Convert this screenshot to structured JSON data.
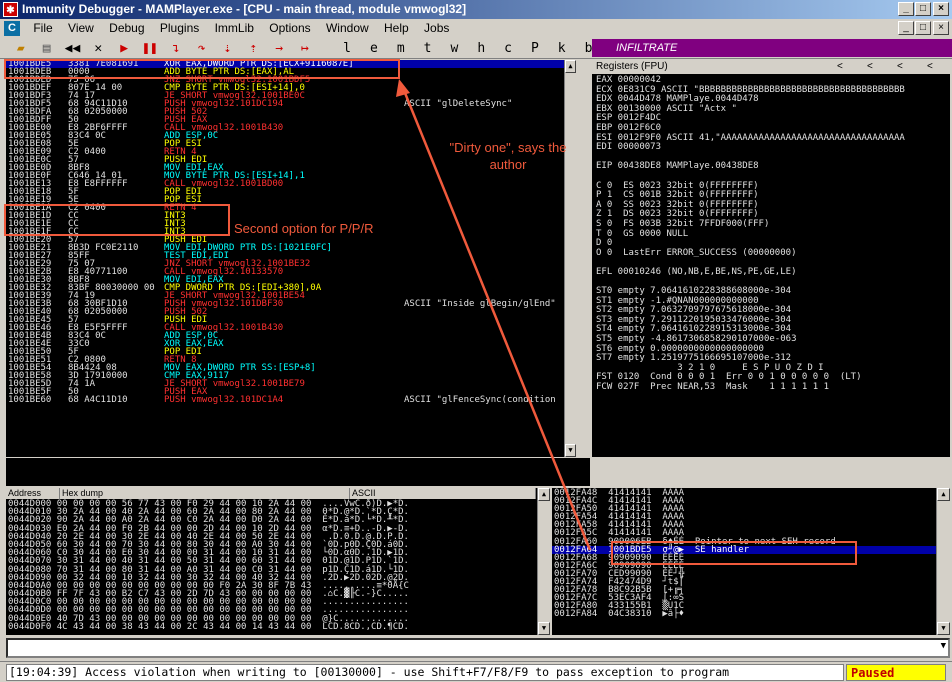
{
  "window": {
    "title": "Immunity Debugger - MAMPlayer.exe - [CPU - main thread, module vmwogl32]",
    "title_icon": "bug-icon",
    "controls": [
      "_",
      "□",
      "×"
    ],
    "mdi_controls": [
      "_",
      "□",
      "×"
    ]
  },
  "menu": [
    "File",
    "View",
    "Debug",
    "Plugins",
    "ImmLib",
    "Options",
    "Window",
    "Help",
    "Jobs"
  ],
  "toolbar": {
    "letters": [
      "l",
      "e",
      "m",
      "t",
      "w",
      "h",
      "c",
      "P",
      "k",
      "b",
      "z",
      "r",
      "...",
      "s",
      "?"
    ],
    "infiltrate": "INFILTRATE"
  },
  "disasm": [
    {
      "a": "1001BDE5",
      "h": "3381 7E081691",
      "i": "XOR EAX,DWORD PTR DS:[ECX+9116087E]",
      "k": "wht",
      "c": ""
    },
    {
      "a": "1001BDEB",
      "h": "0000",
      "i": "ADD BYTE PTR DS:[EAX],AL",
      "k": "yel",
      "c": ""
    },
    {
      "a": "1001BDED",
      "h": "75 06",
      "i": "JNZ SHORT vmwogl32.1001BDF5",
      "k": "red",
      "c": ""
    },
    {
      "a": "1001BDEF",
      "h": "807E 14 00",
      "i": "CMP BYTE PTR DS:[ESI+14],0",
      "k": "yel",
      "c": ""
    },
    {
      "a": "1001BDF3",
      "h": "74 17",
      "i": "JE SHORT vmwogl32.1001BE0C",
      "k": "red",
      "c": ""
    },
    {
      "a": "1001BDF5",
      "h": "68 94C11D10",
      "i": "PUSH vmwogl32.101DC194",
      "k": "red",
      "c": "ASCII \"glDeleteSync\""
    },
    {
      "a": "1001BDFA",
      "h": "68 02050000",
      "i": "PUSH 502",
      "k": "red",
      "c": ""
    },
    {
      "a": "1001BDFF",
      "h": "50",
      "i": "PUSH EAX",
      "k": "red",
      "c": ""
    },
    {
      "a": "1001BE00",
      "h": "E8 2BF6FFFF",
      "i": "CALL vmwogl32.1001B430",
      "k": "red",
      "c": ""
    },
    {
      "a": "1001BE05",
      "h": "83C4 0C",
      "i": "ADD ESP,0C",
      "k": "cyan",
      "c": ""
    },
    {
      "a": "1001BE08",
      "h": "5E",
      "i": "POP ESI",
      "k": "yel",
      "c": ""
    },
    {
      "a": "1001BE09",
      "h": "C2 0400",
      "i": "RETN 4",
      "k": "red",
      "c": ""
    },
    {
      "a": "1001BE0C",
      "h": "57",
      "i": "PUSH EDI",
      "k": "yel",
      "c": ""
    },
    {
      "a": "1001BE0D",
      "h": "8BF8",
      "i": "MOV EDI,EAX",
      "k": "cyan",
      "c": ""
    },
    {
      "a": "1001BE0F",
      "h": "C646 14 01",
      "i": "MOV BYTE PTR DS:[ESI+14],1",
      "k": "cyan",
      "c": ""
    },
    {
      "a": "1001BE13",
      "h": "E8 E8FFFFFF",
      "i": "CALL vmwogl32.1001BD00",
      "k": "red",
      "c": ""
    },
    {
      "a": "1001BE18",
      "h": "5F",
      "i": "POP EDI",
      "k": "yel",
      "c": ""
    },
    {
      "a": "1001BE19",
      "h": "5E",
      "i": "POP ESI",
      "k": "yel",
      "c": ""
    },
    {
      "a": "1001BE1A",
      "h": "C2 0400",
      "i": "RETN 4",
      "k": "red",
      "c": ""
    },
    {
      "a": "1001BE1D",
      "h": "CC",
      "i": "INT3",
      "k": "yel",
      "c": ""
    },
    {
      "a": "1001BE1E",
      "h": "CC",
      "i": "INT3",
      "k": "yel",
      "c": ""
    },
    {
      "a": "1001BE1F",
      "h": "CC",
      "i": "INT3",
      "k": "yel",
      "c": ""
    },
    {
      "a": "1001BE20",
      "h": "57",
      "i": "PUSH EDI",
      "k": "yel",
      "c": ""
    },
    {
      "a": "1001BE21",
      "h": "8B3D FC0E2110",
      "i": "MOV EDI,DWORD PTR DS:[1021E0FC]",
      "k": "cyan",
      "c": ""
    },
    {
      "a": "1001BE27",
      "h": "85FF",
      "i": "TEST EDI,EDI",
      "k": "cyan",
      "c": ""
    },
    {
      "a": "1001BE29",
      "h": "75 07",
      "i": "JNZ SHORT vmwogl32.1001BE32",
      "k": "red",
      "c": ""
    },
    {
      "a": "1001BE2B",
      "h": "E8 40771100",
      "i": "CALL vmwogl32.10133570",
      "k": "red",
      "c": ""
    },
    {
      "a": "1001BE30",
      "h": "8BF8",
      "i": "MOV EDI,EAX",
      "k": "cyan",
      "c": ""
    },
    {
      "a": "1001BE32",
      "h": "83BF 80030000 00",
      "i": "CMP DWORD PTR DS:[EDI+380],0A",
      "k": "yel",
      "c": ""
    },
    {
      "a": "1001BE39",
      "h": "74 19",
      "i": "JE SHORT vmwogl32.1001BE54",
      "k": "red",
      "c": ""
    },
    {
      "a": "1001BE3B",
      "h": "68 30BF1D10",
      "i": "PUSH vmwogl32.101DBF30",
      "k": "red",
      "c": "ASCII \"Inside glBegin/glEnd\""
    },
    {
      "a": "1001BE40",
      "h": "68 02050000",
      "i": "PUSH 502",
      "k": "red",
      "c": ""
    },
    {
      "a": "1001BE45",
      "h": "57",
      "i": "PUSH EDI",
      "k": "yel",
      "c": ""
    },
    {
      "a": "1001BE46",
      "h": "E8 E5F5FFFF",
      "i": "CALL vmwogl32.1001B430",
      "k": "red",
      "c": ""
    },
    {
      "a": "1001BE4B",
      "h": "83C4 0C",
      "i": "ADD ESP,0C",
      "k": "cyan",
      "c": ""
    },
    {
      "a": "1001BE4E",
      "h": "33C0",
      "i": "XOR EAX,EAX",
      "k": "cyan",
      "c": ""
    },
    {
      "a": "1001BE50",
      "h": "5F",
      "i": "POP EDI",
      "k": "yel",
      "c": ""
    },
    {
      "a": "1001BE51",
      "h": "C2 0800",
      "i": "RETN 8",
      "k": "red",
      "c": ""
    },
    {
      "a": "1001BE54",
      "h": "8B4424 08",
      "i": "MOV EAX,DWORD PTR SS:[ESP+8]",
      "k": "cyan",
      "c": ""
    },
    {
      "a": "1001BE58",
      "h": "3D 17910000",
      "i": "CMP EAX,9117",
      "k": "cyan",
      "c": ""
    },
    {
      "a": "1001BE5D",
      "h": "74 1A",
      "i": "JE SHORT vmwogl32.1001BE79",
      "k": "red",
      "c": ""
    },
    {
      "a": "1001BE5F",
      "h": "50",
      "i": "PUSH EAX",
      "k": "red",
      "c": ""
    },
    {
      "a": "1001BE60",
      "h": "68 A4C11D10",
      "i": "PUSH vmwogl32.101DC1A4",
      "k": "red",
      "c": "ASCII \"glFenceSync(condition"
    }
  ],
  "registers_title": "Registers (FPU)",
  "registers": [
    "EAX 00000042",
    "ECX 0E831C9 ASCII \"BBBBBBBBBBBBBBBBBBBBBBBBBBBBBBBBBBBBBB",
    "EDX 0044D478 MAMPlaye.0044D478",
    "EBX 00130000 ASCII \"Actx \"",
    "ESP 0012F4DC",
    "EBP 0012F6C0",
    "ESI 0012F9F0 ASCII 41,\"AAAAAAAAAAAAAAAAAAAAAAAAAAAAAAAAAA",
    "EDI 00000073",
    "",
    "EIP 00438DE8 MAMPlaye.00438DE8",
    "",
    "C 0  ES 0023 32bit 0(FFFFFFFF)",
    "P 1  CS 001B 32bit 0(FFFFFFFF)",
    "A 0  SS 0023 32bit 0(FFFFFFFF)",
    "Z 1  DS 0023 32bit 0(FFFFFFFF)",
    "S 0  FS 003B 32bit 7FFDF000(FFF)",
    "T 0  GS 0000 NULL",
    "D 0",
    "O 0  LastErr ERROR_SUCCESS (00000000)",
    "",
    "EFL 00010246 (NO,NB,E,BE,NS,PE,GE,LE)",
    "",
    "ST0 empty 7.0641610228388608000e-304",
    "ST1 empty -1.#QNAN000000000000",
    "ST2 empty 7.0632709797675618000e-304",
    "ST3 empty 7.2911220195033476000e-304",
    "ST4 empty 7.0641610228915313000e-304",
    "ST5 empty -4.8617306858290107000e-063",
    "ST6 empty 0.0000000000000000000",
    "ST7 empty 1.2519775166695107000e-312",
    "               3 2 1 0     E S P U O Z D I",
    "FST 0120  Cond 0 0 0 1  Err 0 0 1 0 0 0 0 0  (LT)",
    "FCW 027F  Prec NEAR,53  Mask    1 1 1 1 1 1"
  ],
  "hex": {
    "headers": [
      "Address",
      "Hex dump",
      "ASCII"
    ],
    "rows": [
      "0044D000 00 00 00 00 56 77 43 00 F0 29 44 00 10 2A 44 00  ....VwC.ð)D.▶*D.",
      "0044D010 30 2A 44 00 40 2A 44 00 60 2A 44 00 80 2A 44 00  0*D.@*D.`*D.Ç*D.",
      "0044D020 90 2A 44 00 A0 2A 44 00 C0 2A 44 00 D0 2A 44 00  É*D.á*D.└*D.╨*D.",
      "0044D030 E0 2A 44 00 F0 2B 44 00 00 2D 44 00 10 2D 44 00  α*D.≡+D..-D.▶-D.",
      "0044D040 20 2E 44 00 30 2E 44 00 40 2E 44 00 50 2E 44 00   .D.0.D.@.D.P.D.",
      "0044D050 60 30 44 00 70 30 44 00 80 30 44 00 A0 30 44 00  `0D.p0D.Ç0D.á0D.",
      "0044D060 C0 30 44 00 E0 30 44 00 00 31 44 00 10 31 44 00  └0D.α0D..1D.▶1D.",
      "0044D070 30 31 44 00 40 31 44 00 50 31 44 00 60 31 44 00  01D.@1D.P1D.`1D.",
      "0044D080 70 31 44 00 80 31 44 00 A0 31 44 00 C0 31 44 00  p1D.Ç1D.á1D.└1D.",
      "0044D090 00 32 44 00 10 32 44 00 30 32 44 00 40 32 44 00  .2D.▶2D.02D.@2D.",
      "0044D0A0 00 00 00 00 00 00 00 00 00 00 F0 2A 30 8F 7B 43  ..........≡*0Å{C",
      "0044D0B0 FF 7F 43 00 B2 C7 43 00 2D 7D 43 00 00 00 00 00  .⌂C.▓╟C.-}C.....",
      "0044D0C0 00 00 00 00 00 00 00 00 00 00 00 00 00 00 00 00  ................",
      "0044D0D0 00 00 00 00 00 00 00 00 00 00 00 00 00 00 00 00  ................",
      "0044D0E0 40 7D 43 00 00 00 00 00 00 00 00 00 00 00 00 00  @}C.............",
      "0044D0F0 4C 43 44 00 38 43 44 00 2C 43 44 00 14 43 44 00  LCD.8CD.,CD.¶CD."
    ]
  },
  "stack": [
    "0012FA48  41414141  AAAA",
    "0012FA4C  41414141  AAAA",
    "0012FA50  41414141  AAAA",
    "0012FA54  41414141  AAAA",
    "0012FA58  41414141  AAAA",
    "0012FA5C  41414141  AAAA",
    "0012FA60  909006EB  δ♠ÉÉ  Pointer to next SEH record",
    "0012FA64  1001BDE5  σ╜@▶  SE handler",
    "0012FA68  90909090  ÉÉÉÉ",
    "0012FA6C  90909090  ÉÉÉÉ",
    "0012FA70  CED99090  ÉÉ┘╬",
    "0012FA74  F42474D9  ┘t$⌠",
    "0012FA78  B8C92B5B  [+╔╕",
    "0012FA7C  53EC3AF4  ⌠:∞S",
    "0012FA80  433155B1  ▒U1C",
    "0012FA84  04C38310  ▶â├♦"
  ],
  "annotations": {
    "dirty_one": "\"Dirty one\", says the author",
    "second_option": "Second option for P/P/R"
  },
  "status": {
    "message": "[19:04:39] Access violation when writing to [00130000] - use Shift+F7/F8/F9 to pass exception to program",
    "state": "Paused"
  },
  "colors": {
    "annotation": "#f05a3c",
    "selection": "#0000a8",
    "paused_bg": "#ffff00"
  }
}
